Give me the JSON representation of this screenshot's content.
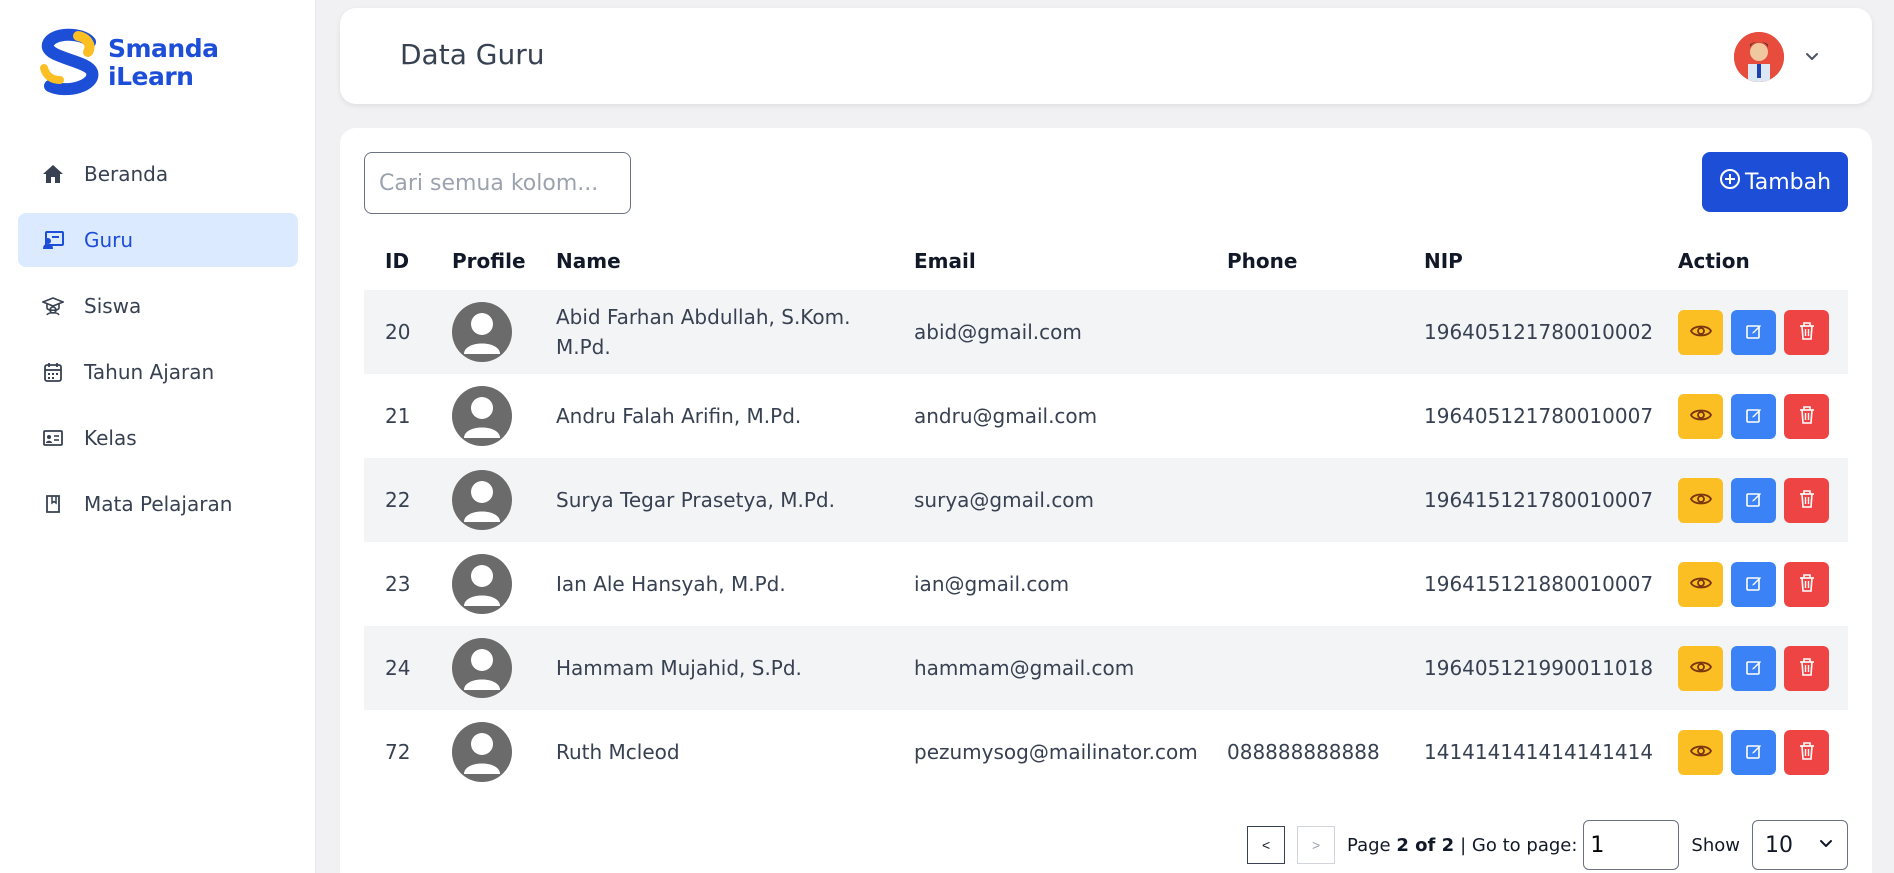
{
  "app": {
    "logo_line1": "Smanda",
    "logo_line2": "iLearn"
  },
  "sidebar": {
    "items": [
      {
        "label": "Beranda",
        "icon": "home-icon",
        "active": false
      },
      {
        "label": "Guru",
        "icon": "teacher-icon",
        "active": true
      },
      {
        "label": "Siswa",
        "icon": "graduation-icon",
        "active": false
      },
      {
        "label": "Tahun Ajaran",
        "icon": "calendar-icon",
        "active": false
      },
      {
        "label": "Kelas",
        "icon": "classroom-icon",
        "active": false
      },
      {
        "label": "Mata Pelajaran",
        "icon": "book-icon",
        "active": false
      }
    ]
  },
  "header": {
    "title": "Data Guru"
  },
  "toolbar": {
    "search_placeholder": "Cari semua kolom...",
    "add_label": "Tambah"
  },
  "table": {
    "columns": [
      "ID",
      "Profile",
      "Name",
      "Email",
      "Phone",
      "NIP",
      "Action"
    ],
    "rows": [
      {
        "id": "20",
        "name": "Abid Farhan Abdullah, S.Kom. M.Pd.",
        "email": "abid@gmail.com",
        "phone": "",
        "nip": "196405121780010002"
      },
      {
        "id": "21",
        "name": "Andru Falah Arifin, M.Pd.",
        "email": "andru@gmail.com",
        "phone": "",
        "nip": "196405121780010007"
      },
      {
        "id": "22",
        "name": "Surya Tegar Prasetya, M.Pd.",
        "email": "surya@gmail.com",
        "phone": "",
        "nip": "196415121780010007"
      },
      {
        "id": "23",
        "name": "Ian Ale Hansyah, M.Pd.",
        "email": "ian@gmail.com",
        "phone": "",
        "nip": "196415121880010007"
      },
      {
        "id": "24",
        "name": "Hammam Mujahid, S.Pd.",
        "email": "hammam@gmail.com",
        "phone": "",
        "nip": "196405121990011018"
      },
      {
        "id": "72",
        "name": "Ruth Mcleod",
        "email": "pezumysog@mailinator.com",
        "phone": "088888888888",
        "nip": "141414141414141414"
      }
    ]
  },
  "pagination": {
    "prev_label": "<",
    "next_label": ">",
    "page_prefix": "Page",
    "page_current": "2 of 2",
    "goto_label": "| Go to page:",
    "goto_value": "1",
    "show_label": "Show",
    "show_value": "10"
  },
  "colors": {
    "primary": "#1d4ed8",
    "view_button": "#fbbf24",
    "edit_button": "#3b82f6",
    "delete_button": "#ef4444",
    "active_nav_bg": "#dbeafe"
  }
}
